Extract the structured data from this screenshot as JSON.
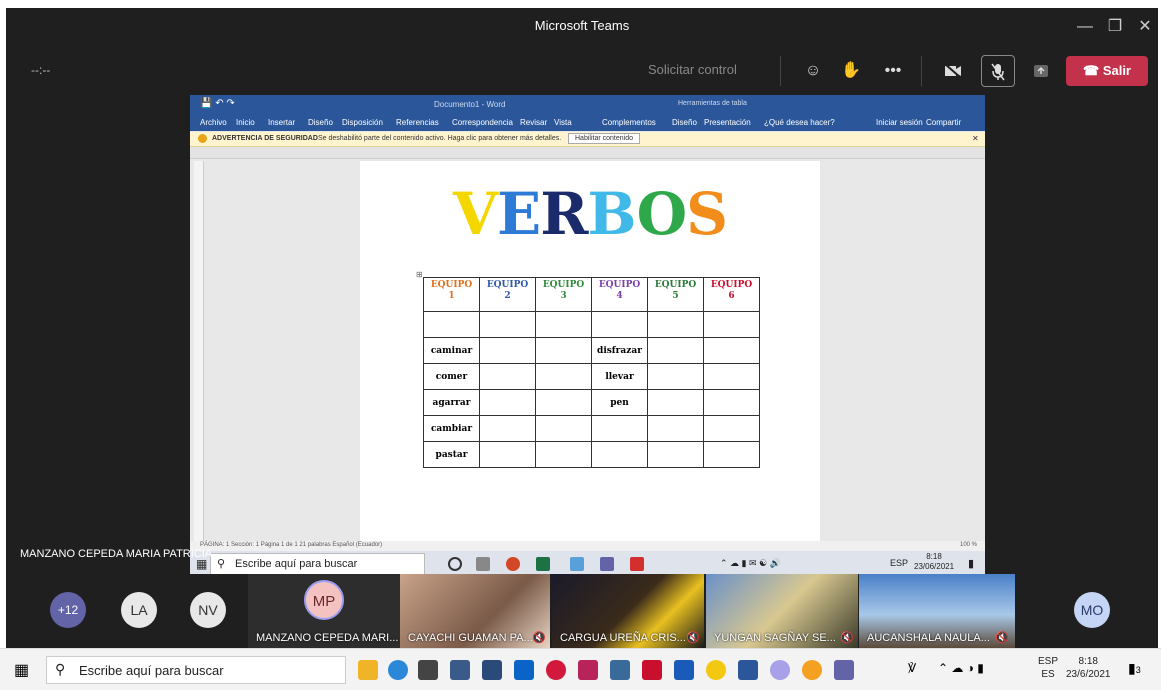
{
  "teams": {
    "title": "Microsoft Teams",
    "timer": "--:--",
    "request_control": "Solicitar control",
    "leave_label": "Salir",
    "presenter_name": "MANZANO CEPEDA MARIA PATRICIA"
  },
  "word": {
    "title": "Documento1 - Word",
    "context_tab": "Herramientas de tabla",
    "tabs": [
      "Archivo",
      "Inicio",
      "Insertar",
      "Diseño",
      "Disposición",
      "Referencias",
      "Correspondencia",
      "Revisar",
      "Vista",
      "Complementos",
      "Diseño",
      "Presentación"
    ],
    "tell_me": "¿Qué desea hacer?",
    "signin": "Iniciar sesión",
    "share": "Compartir",
    "warning_title": "ADVERTENCIA DE SEGURIDAD",
    "warning_text": "Se deshabilitó parte del contenido activo. Haga clic para obtener más detalles.",
    "enable_button": "Habilitar contenido",
    "status": "PÁGINA: 1   Sección: 1   Página 1 de 1   21 palabras   Español (Ecuador)",
    "zoom": "100 %",
    "heading_letters": [
      {
        "char": "V",
        "color": "#f5d700"
      },
      {
        "char": "E",
        "color": "#2e7bd6"
      },
      {
        "char": "R",
        "color": "#1b2a6b"
      },
      {
        "char": "B",
        "color": "#40b8e8"
      },
      {
        "char": "O",
        "color": "#2ea84a"
      },
      {
        "char": "S",
        "color": "#f28c1a"
      }
    ],
    "table": {
      "headers": [
        {
          "line1": "EQUIPO",
          "line2": "1",
          "color": "#e07020"
        },
        {
          "line1": "EQUIPO",
          "line2": "2",
          "color": "#2e5aa8"
        },
        {
          "line1": "EQUIPO",
          "line2": "3",
          "color": "#2f8a3a"
        },
        {
          "line1": "EQUIPO",
          "line2": "4",
          "color": "#7a3fa8"
        },
        {
          "line1": "EQUIPO",
          "line2": "5",
          "color": "#2a7a3a"
        },
        {
          "line1": "EQUIPO",
          "line2": "6",
          "color": "#c8102e"
        }
      ],
      "rows": [
        [
          "",
          "",
          "",
          "",
          "",
          ""
        ],
        [
          "caminar",
          "",
          "",
          "disfrazar",
          "",
          ""
        ],
        [
          "comer",
          "",
          "",
          "llevar",
          "",
          ""
        ],
        [
          "agarrar",
          "",
          "",
          "pen",
          "",
          ""
        ],
        [
          "cambiar",
          "",
          "",
          "",
          "",
          ""
        ],
        [
          "pastar",
          "",
          "",
          "",
          "",
          ""
        ]
      ]
    },
    "inner_search": "Escribe aquí para buscar",
    "inner_lang": "ESP",
    "inner_time": "8:18",
    "inner_date": "23/06/2021"
  },
  "gallery": {
    "more_count": "+12",
    "avatars": [
      {
        "initials": "LA",
        "bg": "#e8e8e8",
        "fg": "#333"
      },
      {
        "initials": "NV",
        "bg": "#e8e8e8",
        "fg": "#333"
      }
    ],
    "main_avatar": {
      "initials": "MP",
      "bg": "#f4c2c0",
      "fg": "#6b2a2a"
    },
    "tiles": [
      {
        "name": "MANZANO CEPEDA MARI..."
      },
      {
        "name": "CAYACHI GUAMAN PA..."
      },
      {
        "name": "CARGUA UREÑA CRIS..."
      },
      {
        "name": "YUNGAN SAGÑAY SE..."
      },
      {
        "name": "AUCANSHALA NAULA..."
      }
    ],
    "last_avatar": {
      "initials": "MO",
      "bg": "#c5d5f5",
      "fg": "#2a3a6b"
    }
  },
  "taskbar": {
    "search_placeholder": "Escribe aquí para buscar",
    "lang_top": "ESP",
    "lang_bottom": "ES",
    "time": "8:18",
    "date": "23/6/2021",
    "notifications": "3"
  }
}
